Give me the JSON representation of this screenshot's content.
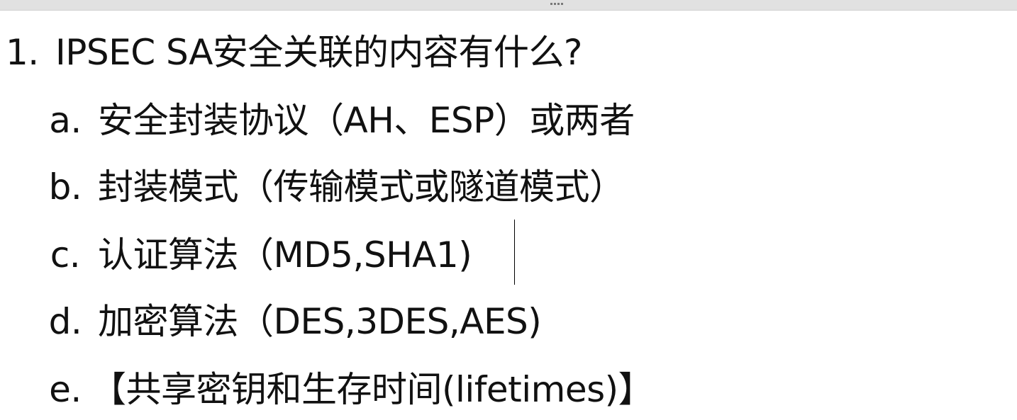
{
  "question": {
    "number": "1.",
    "text": "IPSEC SA安全关联的内容有什么?"
  },
  "items": [
    {
      "marker": "a.",
      "text": "安全封装协议（AH、ESP）或两者"
    },
    {
      "marker": "b.",
      "text": "封装模式（传输模式或隧道模式）"
    },
    {
      "marker": "c.",
      "text": "认证算法（MD5,SHA1)"
    },
    {
      "marker": "d.",
      "text": "加密算法（DES,3DES,AES)"
    },
    {
      "marker": "e.",
      "text": "【共享密钥和生存时间(lifetimes)】"
    }
  ],
  "colors": {
    "text": "#111111",
    "toolbar": "#e1e1e1",
    "background": "#ffffff"
  },
  "icons": [
    "resize-grip-icon",
    "text-cursor-icon"
  ]
}
